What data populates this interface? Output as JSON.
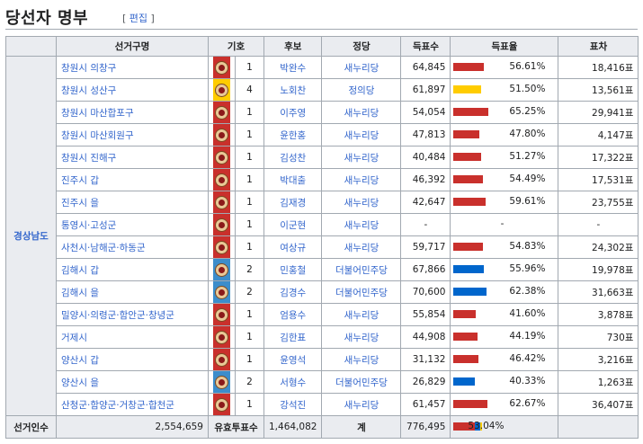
{
  "heading": {
    "title": "당선자 명부",
    "edit_open": "[",
    "edit_label": "편집",
    "edit_close": "]"
  },
  "columns": [
    "선거구명",
    "기호",
    "후보",
    "정당",
    "득표수",
    "득표율",
    "표차"
  ],
  "region": "경상남도",
  "colors": {
    "saenuri": "#c9302c",
    "justice": "#ffcc00",
    "minju_bg": "#3c8dcb",
    "minju_bar": "#0066cc"
  },
  "rows": [
    {
      "district": "창원시 의창구",
      "num": "1",
      "candidate": "박완수",
      "party": "새누리당",
      "votes": "64,845",
      "pct": 56.61,
      "pct_label": "56.61%",
      "margin": "18,416표",
      "color": "r"
    },
    {
      "district": "창원시 성산구",
      "num": "4",
      "candidate": "노회찬",
      "party": "정의당",
      "votes": "61,897",
      "pct": 51.5,
      "pct_label": "51.50%",
      "margin": "13,561표",
      "color": "y"
    },
    {
      "district": "창원시 마산합포구",
      "num": "1",
      "candidate": "이주영",
      "party": "새누리당",
      "votes": "54,054",
      "pct": 65.25,
      "pct_label": "65.25%",
      "margin": "29,941표",
      "color": "r"
    },
    {
      "district": "창원시 마산회원구",
      "num": "1",
      "candidate": "윤한홍",
      "party": "새누리당",
      "votes": "47,813",
      "pct": 47.8,
      "pct_label": "47.80%",
      "margin": "4,147표",
      "color": "r"
    },
    {
      "district": "창원시 진해구",
      "num": "1",
      "candidate": "김성찬",
      "party": "새누리당",
      "votes": "40,484",
      "pct": 51.27,
      "pct_label": "51.27%",
      "margin": "17,322표",
      "color": "r"
    },
    {
      "district": "진주시 갑",
      "num": "1",
      "candidate": "박대출",
      "party": "새누리당",
      "votes": "46,392",
      "pct": 54.49,
      "pct_label": "54.49%",
      "margin": "17,531표",
      "color": "r"
    },
    {
      "district": "진주시 을",
      "num": "1",
      "candidate": "김재경",
      "party": "새누리당",
      "votes": "42,647",
      "pct": 59.61,
      "pct_label": "59.61%",
      "margin": "23,755표",
      "color": "r"
    },
    {
      "district": "통영시·고성군",
      "num": "1",
      "candidate": "이군현",
      "party": "새누리당",
      "votes": "-",
      "pct": 0,
      "pct_label": "-",
      "margin": "-",
      "color": "r"
    },
    {
      "district": "사천시·남해군·하동군",
      "num": "1",
      "candidate": "여상규",
      "party": "새누리당",
      "votes": "59,717",
      "pct": 54.83,
      "pct_label": "54.83%",
      "margin": "24,302표",
      "color": "r"
    },
    {
      "district": "김해시 갑",
      "num": "2",
      "candidate": "민홍철",
      "party": "더불어민주당",
      "votes": "67,866",
      "pct": 55.96,
      "pct_label": "55.96%",
      "margin": "19,978표",
      "color": "b"
    },
    {
      "district": "김해시 을",
      "num": "2",
      "candidate": "김경수",
      "party": "더불어민주당",
      "votes": "70,600",
      "pct": 62.38,
      "pct_label": "62.38%",
      "margin": "31,663표",
      "color": "b"
    },
    {
      "district": "밀양시·의령군·함안군·창녕군",
      "num": "1",
      "candidate": "엄용수",
      "party": "새누리당",
      "votes": "55,854",
      "pct": 41.6,
      "pct_label": "41.60%",
      "margin": "3,878표",
      "color": "r"
    },
    {
      "district": "거제시",
      "num": "1",
      "candidate": "김한표",
      "party": "새누리당",
      "votes": "44,908",
      "pct": 44.19,
      "pct_label": "44.19%",
      "margin": "730표",
      "color": "r"
    },
    {
      "district": "양산시 갑",
      "num": "1",
      "candidate": "윤영석",
      "party": "새누리당",
      "votes": "31,132",
      "pct": 46.42,
      "pct_label": "46.42%",
      "margin": "3,216표",
      "color": "r"
    },
    {
      "district": "양산시 을",
      "num": "2",
      "candidate": "서형수",
      "party": "더불어민주당",
      "votes": "26,829",
      "pct": 40.33,
      "pct_label": "40.33%",
      "margin": "1,263표",
      "color": "b"
    },
    {
      "district": "산청군·함양군·거창군·합천군",
      "num": "1",
      "candidate": "강석진",
      "party": "새누리당",
      "votes": "61,457",
      "pct": 62.67,
      "pct_label": "62.67%",
      "margin": "36,407표",
      "color": "r"
    }
  ],
  "totals": {
    "electors_label": "선거인수",
    "electors": "2,554,659",
    "valid_label": "유효투표수",
    "valid": "1,464,082",
    "sum_label": "계",
    "sum_votes": "776,495",
    "sum_pct": 53.04,
    "sum_pct_label": "53.04%",
    "sum_split": {
      "r": 0.74,
      "b": 0.2,
      "y": 0.06
    }
  }
}
